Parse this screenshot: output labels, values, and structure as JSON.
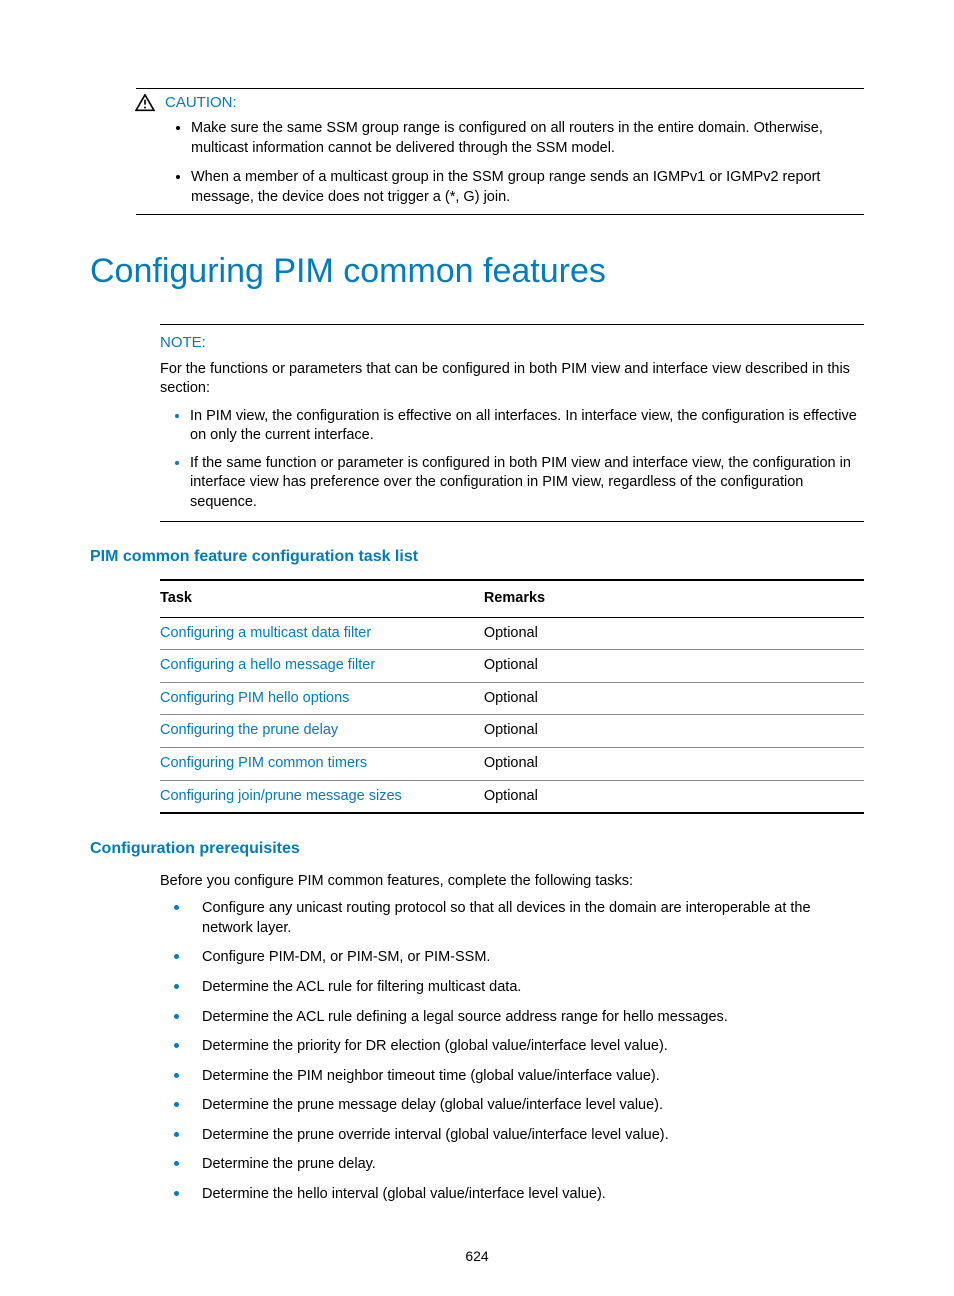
{
  "caution": {
    "label": "CAUTION:",
    "items": [
      "Make sure the same SSM group range is configured on all routers in the entire domain. Otherwise, multicast information cannot be delivered through the SSM model.",
      "When a member of a multicast group in the SSM group range sends an IGMPv1 or IGMPv2 report message, the device does not trigger a (*, G) join."
    ]
  },
  "h1": "Configuring PIM common features",
  "note": {
    "label": "NOTE:",
    "intro": "For the functions or parameters that can be configured in both PIM view and interface view described in this section:",
    "items": [
      "In PIM view, the configuration is effective on all interfaces. In interface view, the configuration is effective on only the current interface.",
      "If the same function or parameter is configured in both PIM view and interface view, the configuration in interface view has preference over the configuration in PIM view, regardless of the configuration sequence."
    ]
  },
  "taskList": {
    "heading": "PIM common feature configuration task list",
    "headers": {
      "task": "Task",
      "remarks": "Remarks"
    },
    "rows": [
      {
        "task": "Configuring a multicast data filter",
        "remarks": "Optional"
      },
      {
        "task": "Configuring a hello message filter",
        "remarks": "Optional"
      },
      {
        "task": "Configuring PIM hello options",
        "remarks": "Optional"
      },
      {
        "task": "Configuring the prune delay",
        "remarks": "Optional"
      },
      {
        "task": "Configuring PIM common timers",
        "remarks": "Optional"
      },
      {
        "task": "Configuring join/prune message sizes",
        "remarks": "Optional"
      }
    ]
  },
  "prereq": {
    "heading": "Configuration prerequisites",
    "intro": "Before you configure PIM common features, complete the following tasks:",
    "items": [
      "Configure any unicast routing protocol so that all devices in the domain are interoperable at the network layer.",
      "Configure PIM-DM, or PIM-SM, or PIM-SSM.",
      "Determine the ACL rule for filtering multicast data.",
      "Determine the ACL rule defining a legal source address range for hello messages.",
      "Determine the priority for DR election (global value/interface level value).",
      "Determine the PIM neighbor timeout time (global value/interface value).",
      "Determine the prune message delay (global value/interface level value).",
      "Determine the prune override interval (global value/interface level value).",
      "Determine the prune delay.",
      "Determine the hello interval (global value/interface level value)."
    ]
  },
  "pageNumber": "624"
}
